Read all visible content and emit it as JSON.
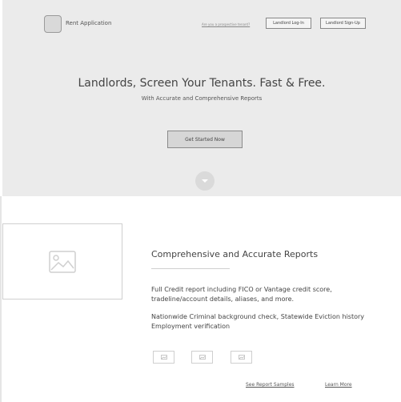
{
  "header": {
    "brand": "Rent Application",
    "tenant_link": "Are you a prospective tenant?",
    "login_label": "Landlord Log-In",
    "signup_label": "Landlord Sign-Up"
  },
  "hero": {
    "headline": "Landlords, Screen Your Tenants. Fast & Free.",
    "subheadline": "With Accurate and Comprehensive Reports",
    "cta_label": "Get Started Now"
  },
  "features": {
    "title": "Comprehensive and Accurate Reports",
    "paragraph1": "Full Credit report including FICO or Vantage credit score, tradeline/account details, aliases, and more.",
    "paragraph2": "Nationwide Criminal background check, Statewide Eviction history Employment verification",
    "see_samples": "See Report Samples",
    "learn_more": "Learn More"
  },
  "icons": {
    "logo": "logo-placeholder-icon",
    "scroll": "chevron-down-icon",
    "image": "image-placeholder-icon",
    "thumbs": [
      "image-thumb-icon",
      "image-thumb-icon",
      "image-thumb-icon"
    ]
  }
}
